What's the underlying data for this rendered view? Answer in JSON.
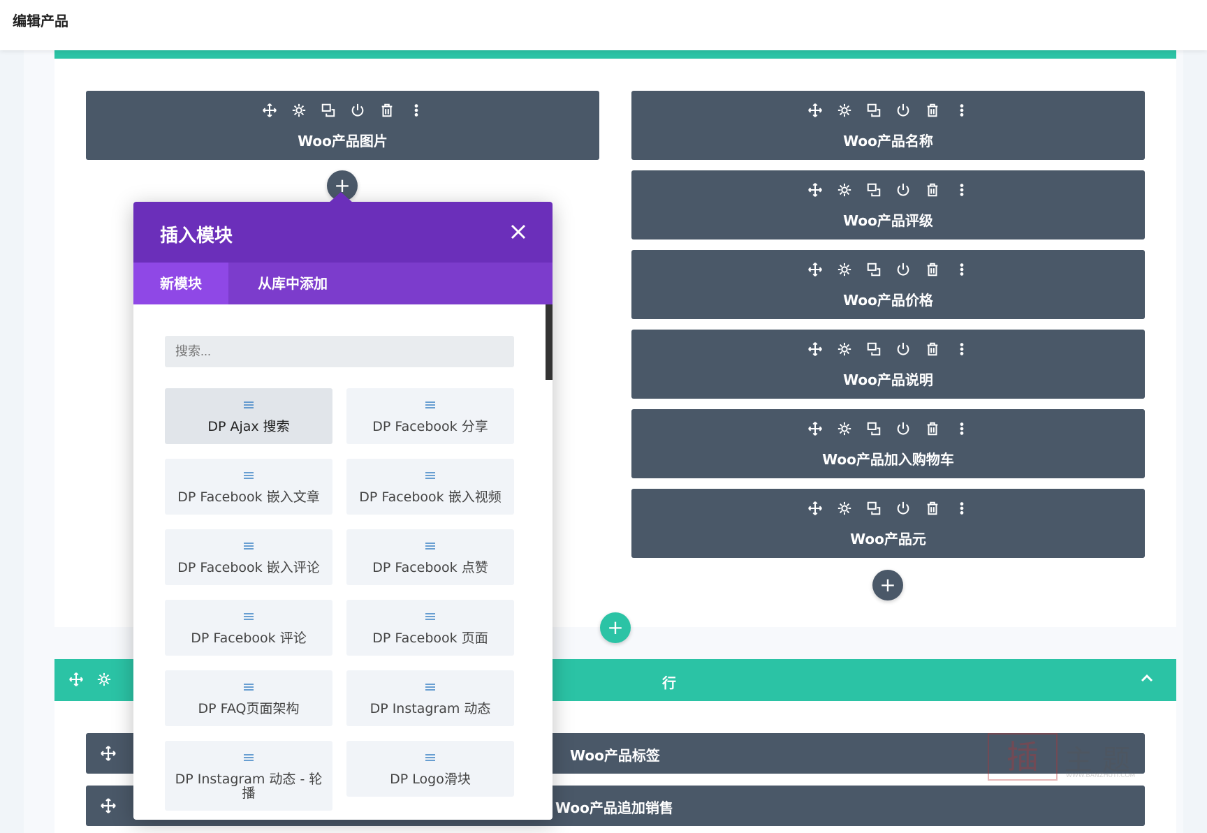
{
  "topbar": {
    "title": "编辑产品"
  },
  "left_column": {
    "module": {
      "label": "Woo产品图片"
    },
    "add_icon": "plus-icon"
  },
  "right_column": {
    "modules": [
      {
        "label": "Woo产品名称"
      },
      {
        "label": "Woo产品评级"
      },
      {
        "label": "Woo产品价格"
      },
      {
        "label": "Woo产品说明"
      },
      {
        "label": "Woo产品加入购物车"
      },
      {
        "label": "Woo产品元"
      }
    ]
  },
  "module_icons": [
    "move-icon",
    "gear-icon",
    "duplicate-icon",
    "power-icon",
    "trash-icon",
    "more-icon"
  ],
  "section2": {
    "row_label": "行",
    "modules": [
      {
        "label": "Woo产品标签"
      },
      {
        "label": "Woo产品追加销售"
      }
    ]
  },
  "popup": {
    "title": "插入模块",
    "tabs": [
      {
        "label": "新模块",
        "active": true
      },
      {
        "label": "从库中添加",
        "active": false
      }
    ],
    "search_placeholder": "搜索...",
    "modules": [
      {
        "label": "DP Ajax 搜索"
      },
      {
        "label": "DP Facebook 分享"
      },
      {
        "label": "DP Facebook 嵌入文章"
      },
      {
        "label": "DP Facebook 嵌入视频"
      },
      {
        "label": "DP Facebook 嵌入评论"
      },
      {
        "label": "DP Facebook 点赞"
      },
      {
        "label": "DP Facebook 评论"
      },
      {
        "label": "DP Facebook 页面"
      },
      {
        "label": "DP FAQ页面架构"
      },
      {
        "label": "DP Instagram 动态"
      },
      {
        "label": "DP Instagram 动态 - 轮播"
      },
      {
        "label": "DP Logo滑块"
      }
    ]
  },
  "watermark": {
    "mark": "插",
    "text": "主题",
    "url": "WWW.BANZHUTI.COM"
  },
  "colors": {
    "accent_green": "#2bc3a5",
    "module_dark": "#4a5868",
    "popup_purple": "#6b2fba",
    "tab_purple": "#7c3ccc",
    "active_tab": "#8f48e6"
  }
}
